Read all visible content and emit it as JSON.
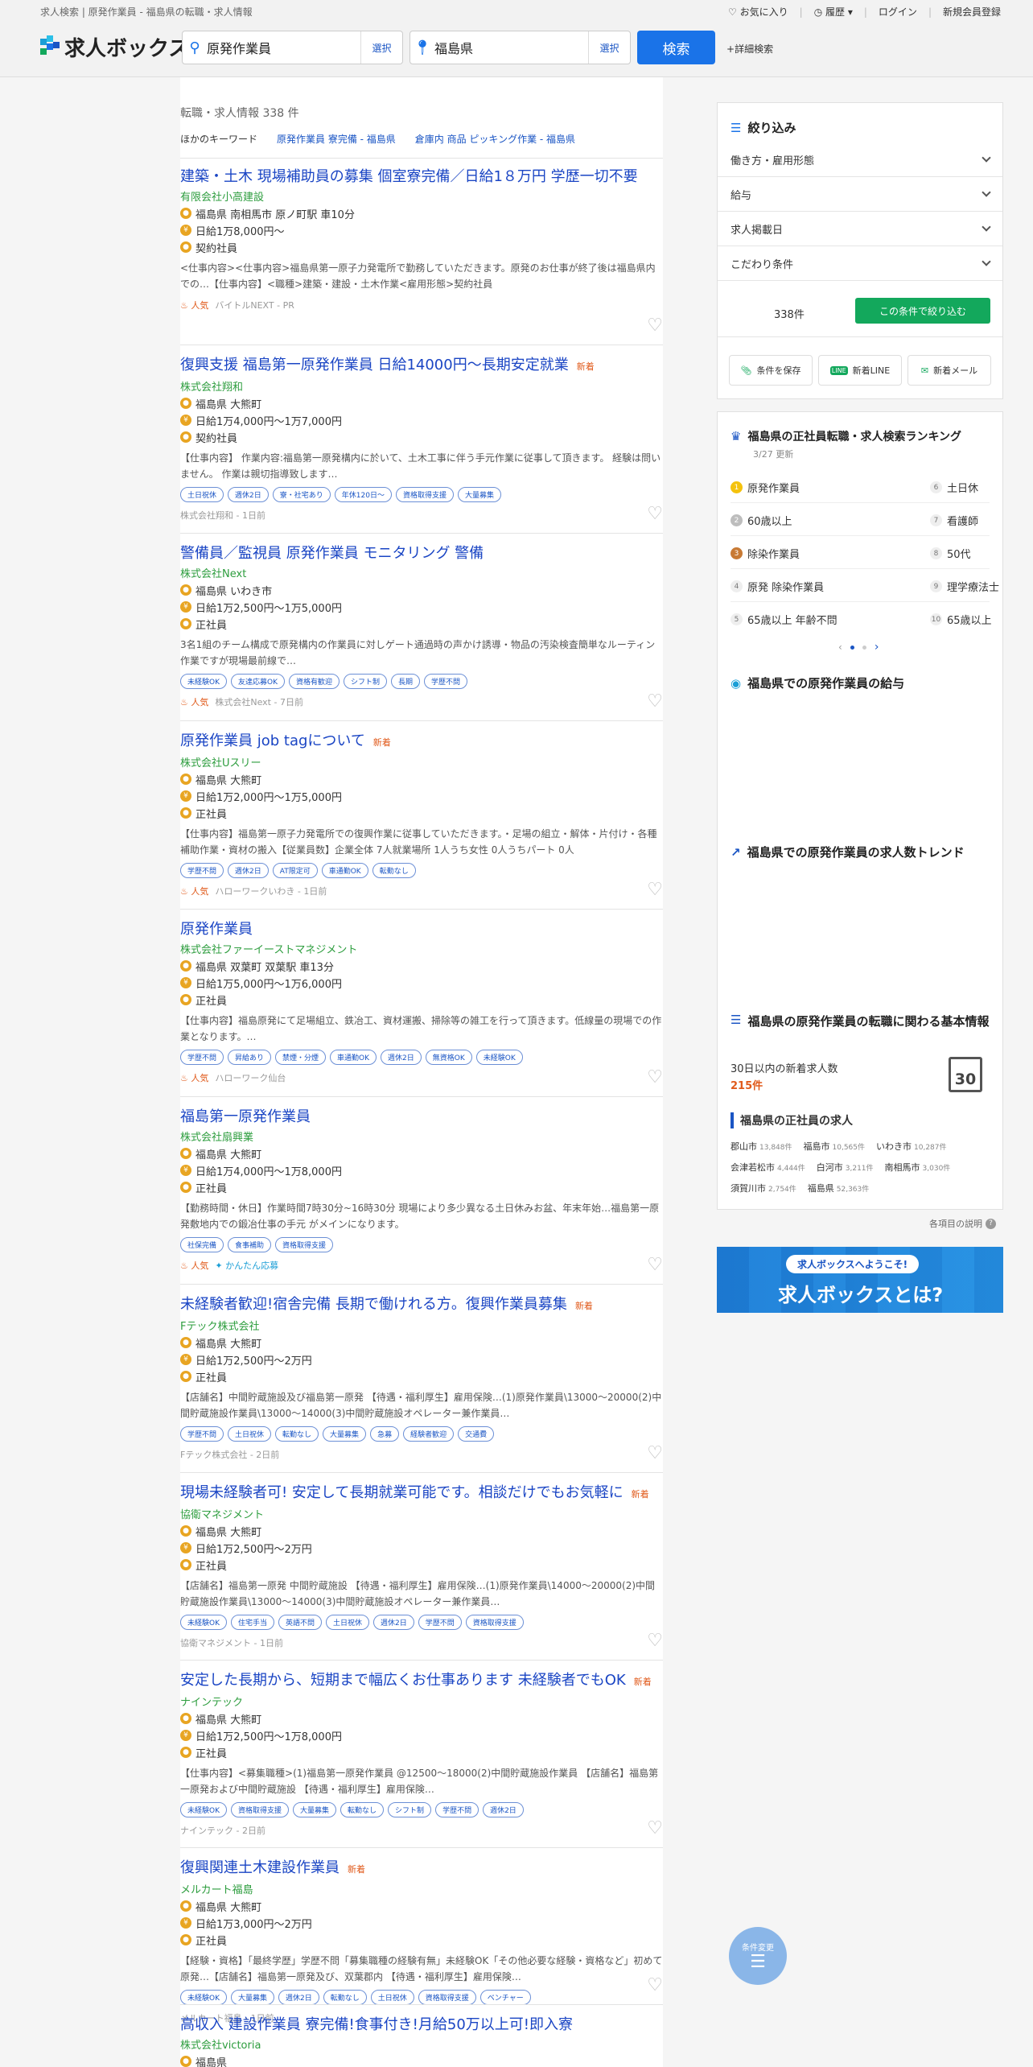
{
  "header": {
    "breadcrumb": "求人検索 | 原発作業員 - 福島県の転職・求人情報",
    "nav": {
      "favorites": "お気に入り",
      "history": "履歴",
      "login": "ログイン",
      "register": "新規会員登録"
    },
    "logo": "求人ボックス",
    "keyword": {
      "value": "原発作業員",
      "select": "選択"
    },
    "location": {
      "value": "福島県",
      "select": "選択"
    },
    "search_btn": "検索",
    "detail": "詳細検索"
  },
  "results": {
    "count": "転職・求人情報 338 件",
    "other_kw_label": "ほかのキーワード",
    "other_kw": [
      "原発作業員 寮完備 - 福島県",
      "倉庫内 商品 ピッキング作業 - 福島県"
    ]
  },
  "jobs": [
    {
      "title": "建築・土木 現場補助員の募集 個室寮完備／日給1８万円 学歴一切不要",
      "new": "",
      "company": "有限会社小高建設",
      "location": "福島県 南相馬市 原ノ町駅 車10分",
      "salary": "日給1万8,000円～",
      "type": "契約社員",
      "desc": "<仕事内容><仕事内容>福島県第一原子力発電所で勤務していただきます。原発のお仕事が終了後は福島県内での…【仕事内容】<職種>建築・建設・土木作業<雇用形態>契約社員",
      "tags": [],
      "hot": "人気",
      "easy": "",
      "source": "バイトルNEXT - PR"
    },
    {
      "title": "復興支援 福島第一原発作業員 日給14000円～長期安定就業",
      "new": "新着",
      "company": "株式会社翔和",
      "location": "福島県 大熊町",
      "salary": "日給1万4,000円～1万7,000円",
      "type": "契約社員",
      "desc": "【仕事内容】 作業内容:福島第一原発構内に於いて、土木工事に伴う手元作業に従事して頂きます。 経験は問いません。 作業は親切指導致します…",
      "tags": [
        "土日祝休",
        "週休2日",
        "寮・社宅あり",
        "年休120日～",
        "資格取得支援",
        "大量募集"
      ],
      "hot": "",
      "easy": "",
      "source": "株式会社翔和 - 1日前"
    },
    {
      "title": "警備員／監視員 原発作業員 モニタリング 警備",
      "new": "",
      "company": "株式会社Next",
      "location": "福島県 いわき市",
      "salary": "日給1万2,500円～1万5,000円",
      "type": "正社員",
      "desc": "3名1組のチーム構成で原発構内の作業員に対しゲート通過時の声かけ誘導・物品の汚染検査簡単なルーティン作業ですが現場最前線で…",
      "tags": [
        "未経験OK",
        "友達応募OK",
        "資格有歓迎",
        "シフト制",
        "長期",
        "学歴不問"
      ],
      "hot": "人気",
      "easy": "",
      "source": "株式会社Next - 7日前"
    },
    {
      "title": "原発作業員 job tagについて",
      "new": "新着",
      "company": "株式会社Uスリー",
      "location": "福島県 大熊町",
      "salary": "日給1万2,000円～1万5,000円",
      "type": "正社員",
      "desc": "【仕事内容】福島第一原子力発電所での復興作業に従事していただきます。・足場の組立・解体・片付け・各種補助作業・資材の搬入【従業員数】企業全体 7人就業場所 1人うち女性 0人うちパート 0人",
      "tags": [
        "学歴不問",
        "週休2日",
        "AT限定可",
        "車通勤OK",
        "転勤なし"
      ],
      "hot": "人気",
      "easy": "",
      "source": "ハローワークいわき - 1日前"
    },
    {
      "title": "原発作業員",
      "new": "",
      "company": "株式会社ファーイーストマネジメント",
      "location": "福島県 双葉町 双葉駅 車13分",
      "salary": "日給1万5,000円～1万6,000円",
      "type": "正社員",
      "desc": "【仕事内容】福島原発にて足場組立、鉄冶工、資材運搬、掃除等の雑工を行って頂きます。低線量の現場での作業となります。…",
      "tags": [
        "学歴不問",
        "昇給あり",
        "禁煙・分煙",
        "車通勤OK",
        "週休2日",
        "無資格OK",
        "未経験OK"
      ],
      "hot": "人気",
      "easy": "",
      "source": "ハローワーク仙台"
    },
    {
      "title": "福島第一原発作業員",
      "new": "",
      "company": "株式会社扇興業",
      "location": "福島県 大熊町",
      "salary": "日給1万4,000円～1万8,000円",
      "type": "正社員",
      "desc": "【勤務時間・休日】作業時間7時30分~16時30分 現場により多少異なる土日休みお盆、年末年始…福島第一原発敷地内での鍛冶仕事の手元 がメインになります。",
      "tags": [
        "社保完備",
        "食事補助",
        "資格取得支援"
      ],
      "hot": "人気",
      "easy": "かんたん応募",
      "source": ""
    },
    {
      "title": "未経験者歓迎!宿舎完備 長期で働けれる方。復興作業員募集",
      "new": "新着",
      "company": "Fテック株式会社",
      "location": "福島県 大熊町",
      "salary": "日給1万2,500円～2万円",
      "type": "正社員",
      "desc": "【店舗名】中間貯蔵施設及び福島第一原発 【待遇・福利厚生】雇用保険…(1)原発作業員\\13000～20000(2)中間貯蔵施設作業員\\13000～14000(3)中間貯蔵施設オペレーター兼作業員…",
      "tags": [
        "学歴不問",
        "土日祝休",
        "転勤なし",
        "大量募集",
        "急募",
        "経験者歓迎",
        "交通費"
      ],
      "hot": "",
      "easy": "",
      "source": "Fテック株式会社 - 2日前"
    },
    {
      "title": "現場未経験者可! 安定して長期就業可能です。相談だけでもお気軽に",
      "new": "新着",
      "company": "協衛マネジメント",
      "location": "福島県 大熊町",
      "salary": "日給1万2,500円～2万円",
      "type": "正社員",
      "desc": "【店舗名】福島第一原発 中間貯蔵施設 【待遇・福利厚生】雇用保険…(1)原発作業員\\14000～20000(2)中間貯蔵施設作業員\\13000～14000(3)中間貯蔵施設オペレーター兼作業員…",
      "tags": [
        "未経験OK",
        "住宅手当",
        "英語不問",
        "土日祝休",
        "週休2日",
        "学歴不問",
        "資格取得支援"
      ],
      "hot": "",
      "easy": "",
      "source": "協衛マネジメント - 1日前"
    },
    {
      "title": "安定した長期から、短期まで幅広くお仕事あります 未経験者でもOK",
      "new": "新着",
      "company": "ナインテック",
      "location": "福島県 大熊町",
      "salary": "日給1万2,500円～1万8,000円",
      "type": "正社員",
      "desc": "【仕事内容】<募集職種>(1)福島第一原発作業員 @12500～18000(2)中間貯蔵施設作業員 【店舗名】福島第一原発および中間貯蔵施設 【待遇・福利厚生】雇用保険…",
      "tags": [
        "未経験OK",
        "資格取得支援",
        "大量募集",
        "転勤なし",
        "シフト制",
        "学歴不問",
        "週休2日"
      ],
      "hot": "",
      "easy": "",
      "source": "ナインテック - 2日前"
    },
    {
      "title": "復興関連土木建設作業員",
      "new": "新着",
      "company": "メルカート福島",
      "location": "福島県 大熊町",
      "salary": "日給1万3,000円～2万円",
      "type": "正社員",
      "desc": "【経験・資格】「最終学歴」学歴不問「募集職種の経験有無」未経験OK「その他必要な経験・資格など」初めて原発…【店舗名】福島第一原発及び、双葉郡内 【待遇・福利厚生】雇用保険…",
      "tags": [
        "未経験OK",
        "大量募集",
        "週休2日",
        "転勤なし",
        "土日祝休",
        "資格取得支援",
        "ベンチャー"
      ],
      "hot": "",
      "easy": "",
      "source": "メルカート福島 - 1日前"
    },
    {
      "title": "高収入 建設作業員 寮完備!食事付き!月給50万以上可!即入寮",
      "new": "",
      "company": "株式会社victoria",
      "location": "福島県",
      "salary": "",
      "type": "",
      "desc": "",
      "tags": [],
      "hot": "",
      "easy": "",
      "source": ""
    }
  ],
  "filters": {
    "title": "絞り込み",
    "items": [
      "働き方・雇用形態",
      "給与",
      "求人掲載日",
      "こだわり条件"
    ],
    "count": "338件",
    "apply_btn": "この条件で絞り込む",
    "save": "条件を保存",
    "line": "新着LINE",
    "mail": "新着メール"
  },
  "ranking": {
    "title": "福島県の正社員転職・求人検索ランキング",
    "updated": "3/27 更新",
    "items": [
      {
        "no": "1",
        "label": "原発作業員"
      },
      {
        "no": "2",
        "label": "60歳以上"
      },
      {
        "no": "3",
        "label": "除染作業員"
      },
      {
        "no": "4",
        "label": "原発 除染作業員"
      },
      {
        "no": "5",
        "label": "65歳以上 年齢不問"
      },
      {
        "no": "6",
        "label": "土日休"
      },
      {
        "no": "7",
        "label": "看護師"
      },
      {
        "no": "8",
        "label": "50代"
      },
      {
        "no": "9",
        "label": "理学療法士"
      },
      {
        "no": "10",
        "label": "65歳以上"
      }
    ]
  },
  "salary_section": {
    "title": "福島県での原発作業員の給与"
  },
  "trend_section": {
    "title": "福島県での原発作業員の求人数トレンド"
  },
  "basic_info": {
    "title": "福島県の原発作業員の転職に関わる基本情報",
    "new_label": "30日以内の新着求人数",
    "new_value": "215件",
    "calendar": "30"
  },
  "fulltime": {
    "title": "福島県の正社員の求人",
    "cities": [
      {
        "name": "郡山市",
        "n": "13,848件"
      },
      {
        "name": "福島市",
        "n": "10,565件"
      },
      {
        "name": "いわき市",
        "n": "10,287件"
      },
      {
        "name": "会津若松市",
        "n": "4,444件"
      },
      {
        "name": "白河市",
        "n": "3,211件"
      },
      {
        "name": "南相馬市",
        "n": "3,030件"
      },
      {
        "name": "須賀川市",
        "n": "2,754件"
      },
      {
        "name": "福島県",
        "n": "52,363件"
      }
    ]
  },
  "explain": "各項目の説明",
  "banner": {
    "line1": "求人ボックスへようこそ!",
    "line2": "求人ボックスとは?"
  },
  "float_btn": "条件変更"
}
